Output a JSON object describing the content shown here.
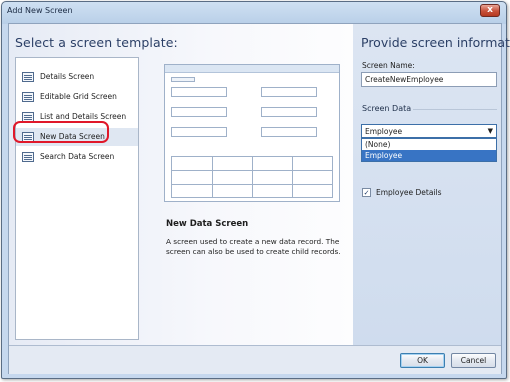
{
  "window": {
    "title": "Add New Screen",
    "close_glyph": "x"
  },
  "left": {
    "heading": "Select a screen template:",
    "templates": [
      {
        "label": "Details Screen",
        "icon": "screen-template-icon"
      },
      {
        "label": "Editable Grid Screen",
        "icon": "screen-template-icon"
      },
      {
        "label": "List and Details Screen",
        "icon": "screen-template-icon"
      },
      {
        "label": "New Data Screen",
        "icon": "screen-template-icon",
        "selected": true
      },
      {
        "label": "Search Data Screen",
        "icon": "screen-template-icon"
      }
    ],
    "description": {
      "title": "New Data Screen",
      "text": "A screen used to create a new data record.  The screen can also be used to create child records."
    }
  },
  "right": {
    "heading": "Provide screen information:",
    "screen_name_label": "Screen Name:",
    "screen_name_value": "CreateNewEmployee",
    "screen_data_label": "Screen Data",
    "screen_data_selected": "Employee",
    "screen_data_options": [
      "(None)",
      "Employee"
    ],
    "employee_details_label": "Employee Details",
    "employee_details_checked": true,
    "check_glyph": "✓",
    "dropdown_arrow": "▼"
  },
  "footer": {
    "ok_label": "OK",
    "cancel_label": "Cancel"
  },
  "colors": {
    "highlight_ring": "#e0182a",
    "selection": "#3874c4",
    "heading": "#2b3f66"
  }
}
